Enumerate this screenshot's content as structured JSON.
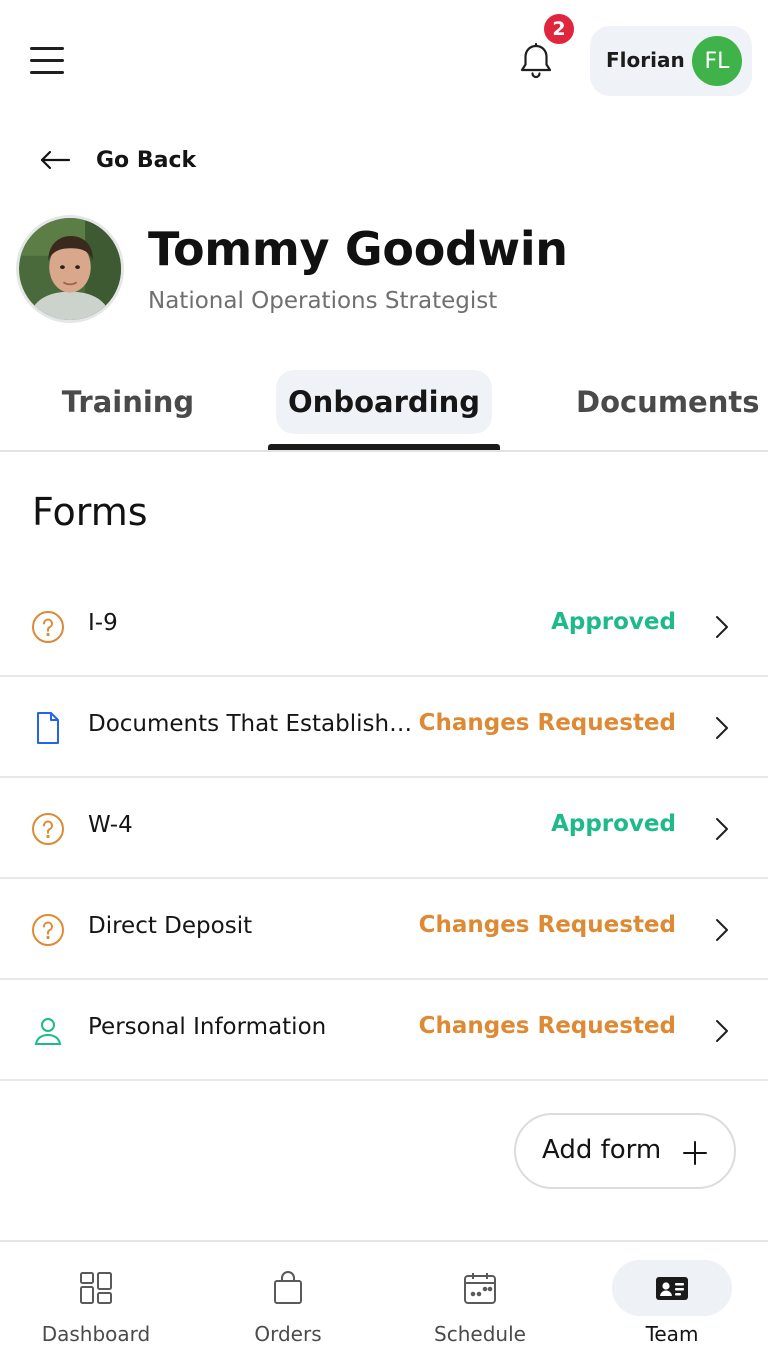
{
  "header": {
    "menu_icon": "hamburger-menu-icon",
    "notifications": {
      "icon": "bell-icon",
      "count": "2",
      "badge_color": "#e0263c"
    },
    "user": {
      "name": "Florian",
      "initials": "FL",
      "avatar_color": "#3fb349"
    }
  },
  "navigation": {
    "back_label": "Go Back",
    "back_icon": "arrow-left-icon"
  },
  "profile": {
    "name": "Tommy Goodwin",
    "title": "National Operations Strategist"
  },
  "tabs": [
    {
      "label": "Training",
      "active": false
    },
    {
      "label": "Onboarding",
      "active": true
    },
    {
      "label": "Documents",
      "active": false
    }
  ],
  "forms": {
    "heading": "Forms",
    "items": [
      {
        "name": "I-9",
        "status": "Approved",
        "icon": "question-circle-icon"
      },
      {
        "name": "Documents That Establish…",
        "status": "Changes Requested",
        "icon": "document-icon"
      },
      {
        "name": "W-4",
        "status": "Approved",
        "icon": "question-circle-icon"
      },
      {
        "name": "Direct Deposit",
        "status": "Changes Requested",
        "icon": "question-circle-icon"
      },
      {
        "name": "Personal Information",
        "status": "Changes Requested",
        "icon": "person-icon"
      }
    ],
    "add_label": "Add form"
  },
  "colors": {
    "approved": "#1fba8a",
    "changes_requested": "#de8a34",
    "accent_blue": "#2563eb"
  },
  "bottom_nav": [
    {
      "label": "Dashboard",
      "icon": "dashboard-grid-icon",
      "active": false
    },
    {
      "label": "Orders",
      "icon": "shopping-bag-icon",
      "active": false
    },
    {
      "label": "Schedule",
      "icon": "calendar-icon",
      "active": false
    },
    {
      "label": "Team",
      "icon": "id-card-icon",
      "active": true
    }
  ]
}
